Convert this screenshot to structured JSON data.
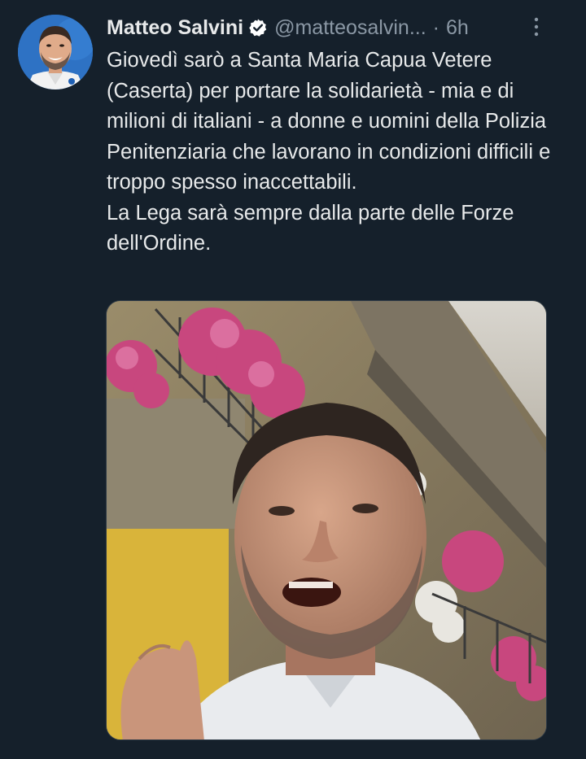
{
  "tweet": {
    "display_name": "Matteo Salvini",
    "verified_icon": "verified-badge-icon",
    "handle": "@matteosalvin...",
    "separator": "·",
    "time": "6h",
    "more_icon": "vertical-dots-icon",
    "text": "Giovedì sarò a Santa Maria Capua Vetere (Caserta) per portare la solidarietà - mia e di milioni di italiani - a donne e uomini della Polizia Penitenziaria che lavorano in condizioni difficili e troppo spesso inaccettabili.\nLa Lega sarà sempre dalla parte delle Forze dell'Ordine."
  },
  "colors": {
    "background": "#15202b",
    "text": "#e7e9ea",
    "muted": "#8b98a5",
    "verified": "#ffffff"
  }
}
